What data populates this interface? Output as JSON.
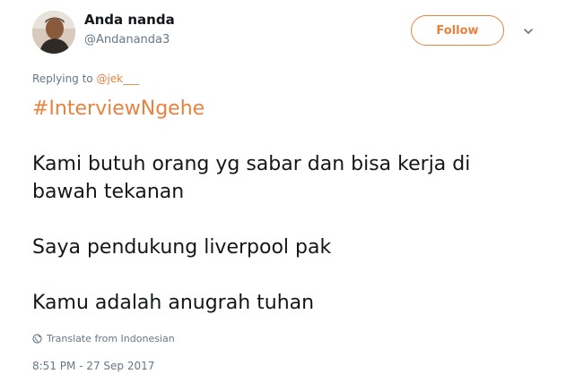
{
  "user": {
    "display_name": "Anda nanda",
    "screen_name": "@Andananda3",
    "follow_label": "Follow"
  },
  "reply": {
    "prefix": "Replying to ",
    "mention": "@jek___"
  },
  "tweet": {
    "hashtag": "#InterviewNgehe",
    "line1": "Kami butuh orang yg sabar dan bisa kerja di",
    "line2": "bawah tekanan",
    "line3": "Saya pendukung liverpool pak",
    "line4": "Kamu adalah anugrah tuhan"
  },
  "translate_label": "Translate from Indonesian",
  "timestamp": "8:51 PM - 27 Sep 2017",
  "colors": {
    "accent": "#e7823f",
    "text": "#14171a",
    "muted": "#657786"
  },
  "icons": {
    "caret": "chevron-down-icon",
    "globe": "globe-icon"
  }
}
